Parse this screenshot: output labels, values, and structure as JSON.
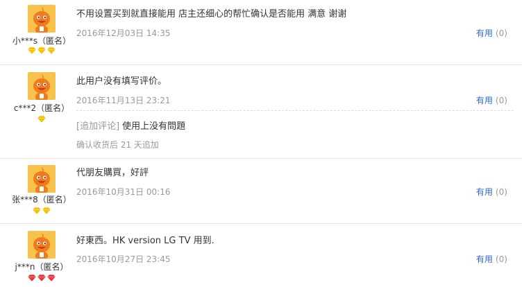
{
  "reviews": [
    {
      "nick": "小***s（匿名）",
      "text": "不用设置买到就直接能用 店主还细心的帮忙确认是否能用 满意 谢谢",
      "date": "2016年12月03日 14:35",
      "useful_label": "有用",
      "useful_count": "(0)",
      "badge_count": 3,
      "badge_type": "gold-diamond"
    },
    {
      "nick": "c***2（匿名）",
      "text": "此用户没有填写评价。",
      "date": "2016年11月13日 23:21",
      "useful_label": "有用",
      "useful_count": "(0)",
      "badge_count": 1,
      "badge_type": "gold-diamond",
      "append_tag": "[追加评论]",
      "append_text": "使用上没有問題",
      "append_note": "确认收货后 21 天追加"
    },
    {
      "nick": "张***8（匿名）",
      "text": "代朋友購買，好評",
      "date": "2016年10月31日 00:16",
      "useful_label": "有用",
      "useful_count": "(0)",
      "badge_count": 2,
      "badge_type": "gold-diamond"
    },
    {
      "nick": "j***n（匿名）",
      "text": "好東西。HK version LG TV 用到.",
      "date": "2016年10月27日 23:45",
      "useful_label": "有用",
      "useful_count": "(0)",
      "badge_count": 3,
      "badge_type": "red-diamond"
    }
  ],
  "colors": {
    "link": "#3366cc",
    "muted": "#999999",
    "avatar_bg": "#f6c24b",
    "avatar_figure": "#f07b1c",
    "gold_diamond": "#f5c200",
    "red_diamond": "#e8363c"
  }
}
